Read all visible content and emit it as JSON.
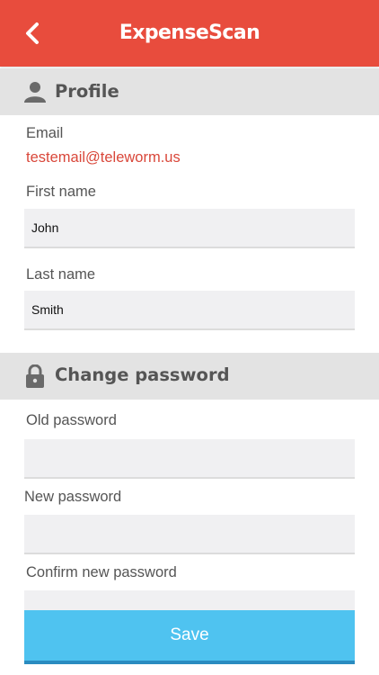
{
  "header": {
    "title": "ExpenseScan",
    "back_icon": "chevron-left-icon",
    "color": "#e84c3d"
  },
  "profile": {
    "title": "Profile",
    "icon": "person-icon",
    "email_label": "Email",
    "email_value": "testemail@teleworm.us",
    "first_name_label": "First name",
    "first_name_value": "John",
    "last_name_label": "Last name",
    "last_name_value": "Smith"
  },
  "password": {
    "title": "Change password",
    "icon": "lock-icon",
    "old_label": "Old password",
    "new_label": "New password",
    "confirm_label": "Confirm new password"
  },
  "save": {
    "label": "Save",
    "color": "#4fc3f0"
  }
}
